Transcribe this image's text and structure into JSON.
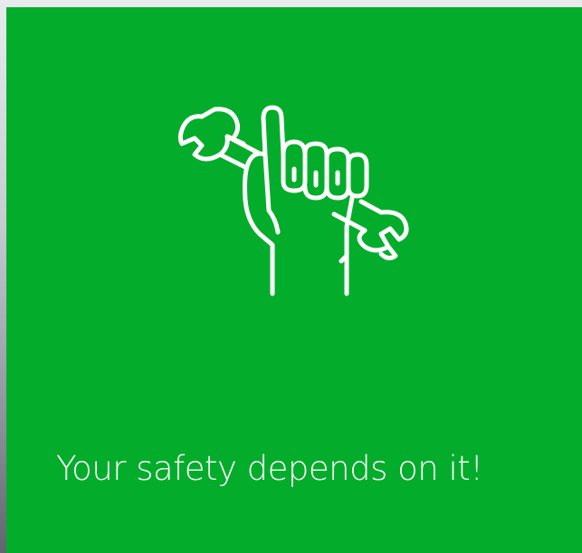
{
  "card": {
    "background_color": "#03ad2b",
    "icon": "hand-holding-wrench-icon",
    "tagline": "Your safety depends on it!",
    "text_color": "#ffffff"
  }
}
